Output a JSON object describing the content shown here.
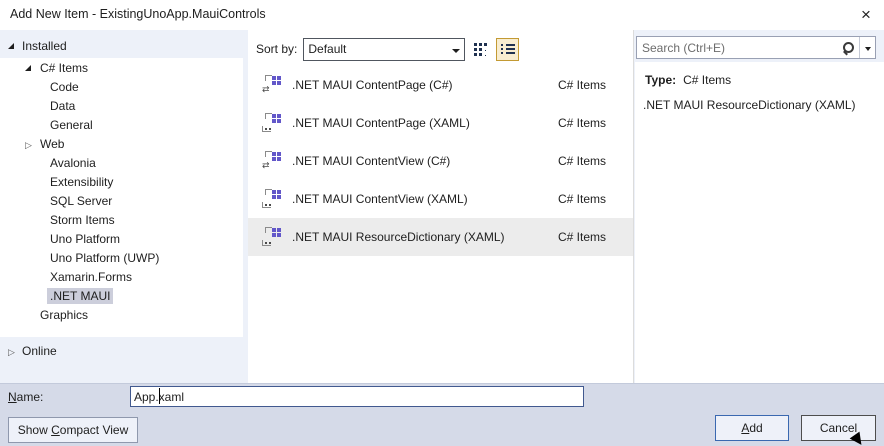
{
  "window": {
    "title": "Add New Item - ExistingUnoApp.MauiControls",
    "close_glyph": "×"
  },
  "sidebar": {
    "installed_label": "Installed",
    "online_label": "Online",
    "tree": [
      {
        "label": "C# Items",
        "level": 1,
        "state": "expanded",
        "selected": false
      },
      {
        "label": "Code",
        "level": 2,
        "selected": false
      },
      {
        "label": "Data",
        "level": 2,
        "selected": false
      },
      {
        "label": "General",
        "level": 2,
        "selected": false
      },
      {
        "label": "Web",
        "level": 2,
        "state": "collapsed",
        "selected": false
      },
      {
        "label": "Avalonia",
        "level": 2,
        "selected": false
      },
      {
        "label": "Extensibility",
        "level": 2,
        "selected": false
      },
      {
        "label": "SQL Server",
        "level": 2,
        "selected": false
      },
      {
        "label": "Storm Items",
        "level": 2,
        "selected": false
      },
      {
        "label": "Uno Platform",
        "level": 2,
        "selected": false
      },
      {
        "label": "Uno Platform (UWP)",
        "level": 2,
        "selected": false
      },
      {
        "label": "Xamarin.Forms",
        "level": 2,
        "selected": false
      },
      {
        "label": ".NET MAUI",
        "level": 2,
        "selected": true
      },
      {
        "label": "Graphics",
        "level": 1,
        "selected": false
      }
    ]
  },
  "toolbar": {
    "sort_by_label": "Sort by:",
    "sort_value": "Default",
    "views": [
      {
        "name": "small-icons",
        "active": false
      },
      {
        "name": "list",
        "active": true
      }
    ]
  },
  "templates": {
    "items": [
      {
        "name": ".NET MAUI ContentPage (C#)",
        "type": "C# Items",
        "icon": "maui-csharp",
        "selected": false
      },
      {
        "name": ".NET MAUI ContentPage (XAML)",
        "type": "C# Items",
        "icon": "maui-xaml",
        "selected": false
      },
      {
        "name": ".NET MAUI ContentView (C#)",
        "type": "C# Items",
        "icon": "maui-csharp",
        "selected": false
      },
      {
        "name": ".NET MAUI ContentView (XAML)",
        "type": "C# Items",
        "icon": "maui-xaml",
        "selected": false
      },
      {
        "name": ".NET MAUI ResourceDictionary (XAML)",
        "type": "C# Items",
        "icon": "maui-xaml",
        "selected": true
      }
    ]
  },
  "details": {
    "search_placeholder": "Search (Ctrl+E)",
    "type_label": "Type:",
    "type_value": "C# Items",
    "description": ".NET MAUI ResourceDictionary (XAML)"
  },
  "footer": {
    "name_label": "Name:",
    "name_value": "App.xaml",
    "compact_button": "Show Compact View",
    "add_button": "Add",
    "cancel_button": "Cancel"
  },
  "colors": {
    "dialog_bg": "#edf1f9",
    "footer_bg": "#d5dae8",
    "tree_selection": "#cccedb",
    "row_selection": "#ececec",
    "view_button_active_border": "#c39a33",
    "view_button_active_bg": "#f8edd0",
    "default_button_border": "#3a68b0",
    "template_icon_purple": "#6257c9"
  }
}
